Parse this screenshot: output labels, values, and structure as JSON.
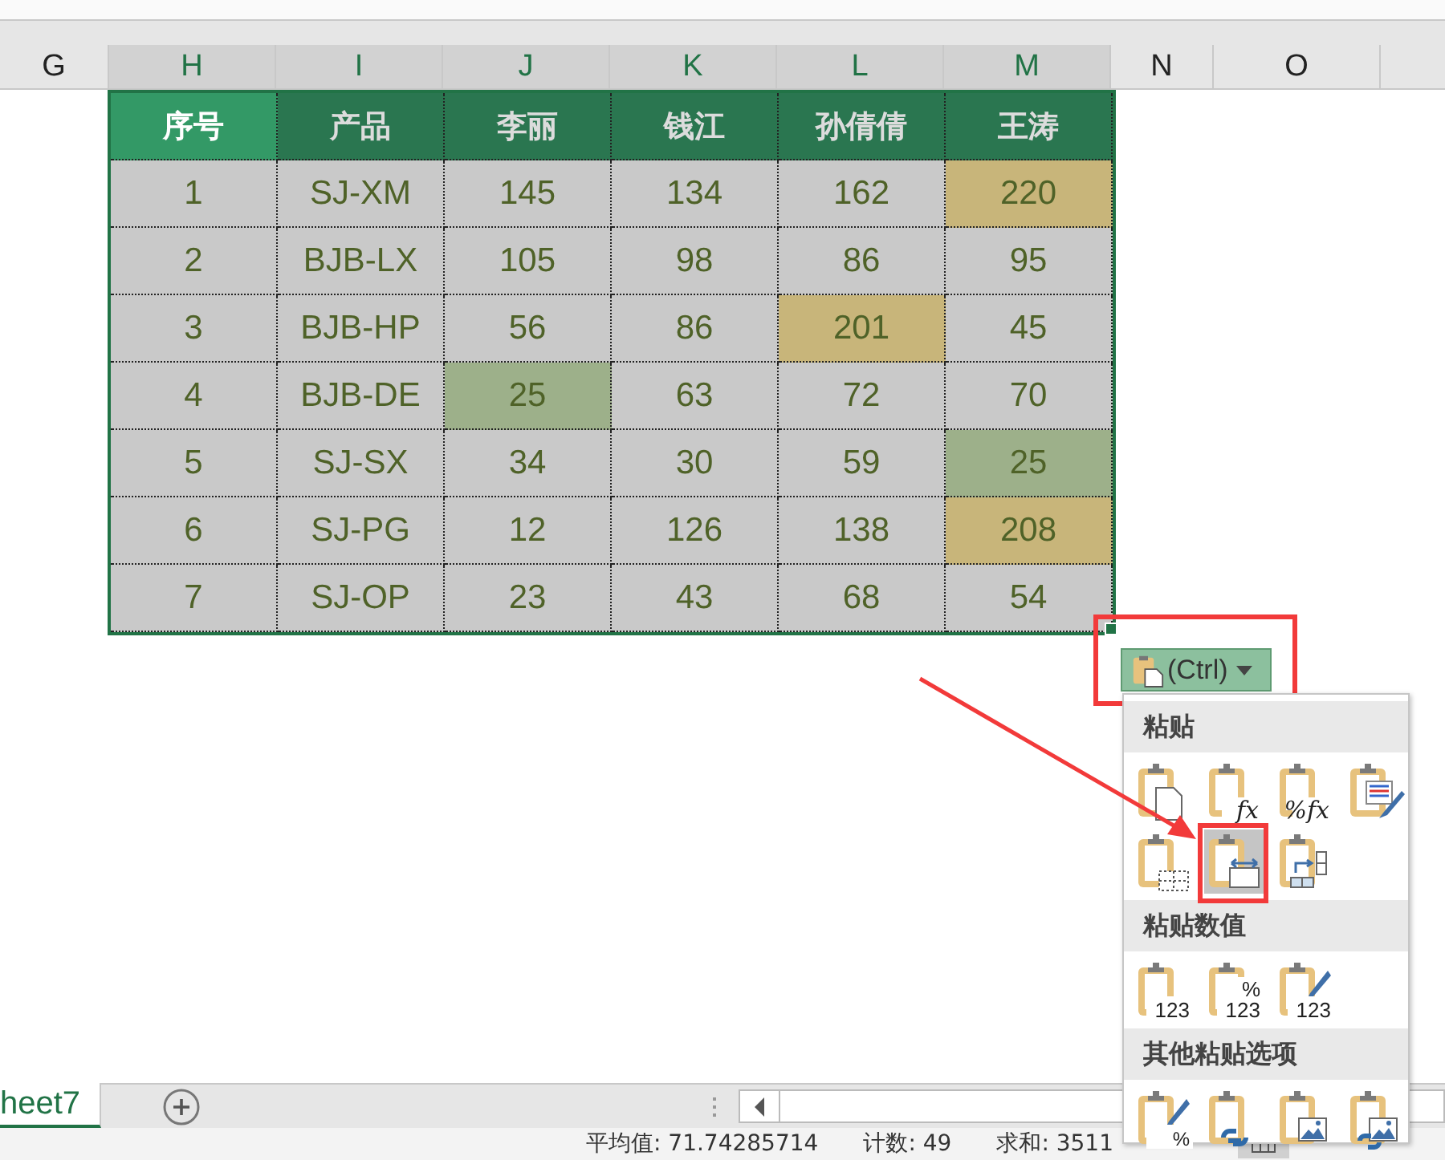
{
  "column_headers": [
    {
      "label": "G",
      "selected": false
    },
    {
      "label": "H",
      "selected": true
    },
    {
      "label": "I",
      "selected": true
    },
    {
      "label": "J",
      "selected": true
    },
    {
      "label": "K",
      "selected": true
    },
    {
      "label": "L",
      "selected": true
    },
    {
      "label": "M",
      "selected": true
    },
    {
      "label": "N",
      "selected": false
    },
    {
      "label": "O",
      "selected": false
    }
  ],
  "table": {
    "columns": [
      {
        "label": "序号",
        "active": true
      },
      {
        "label": "产品",
        "active": false
      },
      {
        "label": "李丽",
        "active": false
      },
      {
        "label": "钱江",
        "active": false
      },
      {
        "label": "孙倩倩",
        "active": false
      },
      {
        "label": "王涛",
        "active": false
      }
    ],
    "rows": [
      [
        {
          "text": "1"
        },
        {
          "text": "SJ-XM"
        },
        {
          "text": "145"
        },
        {
          "text": "134"
        },
        {
          "text": "162"
        },
        {
          "text": "220",
          "color": "#c8b57a"
        }
      ],
      [
        {
          "text": "2"
        },
        {
          "text": "BJB-LX"
        },
        {
          "text": "105"
        },
        {
          "text": "98"
        },
        {
          "text": "86"
        },
        {
          "text": "95"
        }
      ],
      [
        {
          "text": "3"
        },
        {
          "text": "BJB-HP"
        },
        {
          "text": "56"
        },
        {
          "text": "86"
        },
        {
          "text": "201",
          "color": "#c8b57a"
        },
        {
          "text": "45"
        }
      ],
      [
        {
          "text": "4"
        },
        {
          "text": "BJB-DE"
        },
        {
          "text": "25",
          "color": "#9db08a"
        },
        {
          "text": "63"
        },
        {
          "text": "72"
        },
        {
          "text": "70"
        }
      ],
      [
        {
          "text": "5"
        },
        {
          "text": "SJ-SX"
        },
        {
          "text": "34"
        },
        {
          "text": "30"
        },
        {
          "text": "59"
        },
        {
          "text": "25",
          "color": "#9db08a"
        }
      ],
      [
        {
          "text": "6"
        },
        {
          "text": "SJ-PG"
        },
        {
          "text": "12"
        },
        {
          "text": "126"
        },
        {
          "text": "138"
        },
        {
          "text": "208",
          "color": "#c8b57a"
        }
      ],
      [
        {
          "text": "7"
        },
        {
          "text": "SJ-OP"
        },
        {
          "text": "23"
        },
        {
          "text": "43"
        },
        {
          "text": "68"
        },
        {
          "text": "54"
        }
      ]
    ]
  },
  "paste_button": {
    "label": "(Ctrl)"
  },
  "paste_menu": {
    "sections": [
      {
        "title": "粘贴",
        "options": [
          {
            "kind": "paste",
            "selected": false
          },
          {
            "kind": "formulas",
            "glyphs": [
              "fx"
            ],
            "selected": false
          },
          {
            "kind": "formulas",
            "glyphs": [
              "%fx"
            ],
            "selected": false
          },
          {
            "kind": "source-format",
            "selected": false
          },
          {
            "kind": "no-borders",
            "selected": false
          },
          {
            "kind": "column-widths",
            "selected": true
          },
          {
            "kind": "transpose",
            "selected": false
          }
        ]
      },
      {
        "title": "粘贴数值",
        "options": [
          {
            "kind": "values",
            "glyphs": [
              "123"
            ],
            "selected": false
          },
          {
            "kind": "values",
            "glyphs": [
              "%",
              "123"
            ],
            "selected": false
          },
          {
            "kind": "values-format",
            "glyphs": [
              "123"
            ],
            "selected": false
          }
        ]
      },
      {
        "title": "其他粘贴选项",
        "options": [
          {
            "kind": "formatting",
            "glyphs": [
              "%"
            ],
            "selected": false
          },
          {
            "kind": "link",
            "selected": false
          },
          {
            "kind": "picture",
            "selected": false
          },
          {
            "kind": "linked-picture",
            "selected": false
          }
        ]
      }
    ]
  },
  "sheet_tabs": [
    {
      "label": "heet7",
      "selected": true
    }
  ],
  "status_bar": [
    "平均值: 71.74285714",
    "计数: 49",
    "求和: 3511"
  ]
}
